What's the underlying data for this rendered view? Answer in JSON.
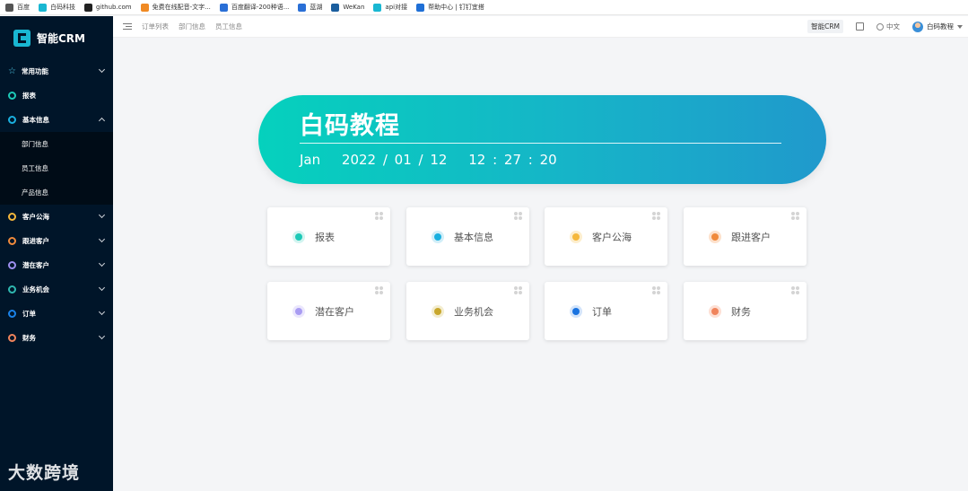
{
  "bookmarks": [
    {
      "label": "百度",
      "color": "#555555",
      "icon": "baidu-icon"
    },
    {
      "label": "白码科技",
      "color": "#19b7d2",
      "icon": "baima-icon"
    },
    {
      "label": "github.com",
      "color": "#222222",
      "icon": "github-icon"
    },
    {
      "label": "免费在线配音-文字...",
      "color": "#f08a24",
      "icon": "voice-icon"
    },
    {
      "label": "百度翻译-200种语...",
      "color": "#2a6fd6",
      "icon": "translate-icon"
    },
    {
      "label": "蓝湖",
      "color": "#2a6fd6",
      "icon": "lanhu-icon"
    },
    {
      "label": "WeKan",
      "color": "#1b5e9e",
      "icon": "wekan-icon"
    },
    {
      "label": "api对接",
      "color": "#19b7d2",
      "icon": "baima-icon"
    },
    {
      "label": "帮助中心 | 钉钉宜搭",
      "color": "#1f6fd6",
      "icon": "yida-icon"
    }
  ],
  "app": {
    "name": "智能CRM"
  },
  "sidebar": {
    "items": [
      {
        "label": "常用功能",
        "icon": "star-icon",
        "color": "#4ec9e8",
        "expanded": false
      },
      {
        "label": "报表",
        "icon": "circle-icon",
        "color": "#1dc9b7",
        "chevron": false
      },
      {
        "label": "基本信息",
        "icon": "circle-icon",
        "color": "#1ab0e0",
        "expanded": true,
        "children": [
          "部门信息",
          "员工信息",
          "产品信息"
        ]
      },
      {
        "label": "客户公海",
        "icon": "circle-icon",
        "color": "#f5b83c"
      },
      {
        "label": "跟进客户",
        "icon": "circle-icon",
        "color": "#f08a3c"
      },
      {
        "label": "潜在客户",
        "icon": "circle-icon",
        "color": "#9d8ff0"
      },
      {
        "label": "业务机会",
        "icon": "circle-icon",
        "color": "#2fb8b0"
      },
      {
        "label": "订单",
        "icon": "circle-icon",
        "color": "#1a82e8"
      },
      {
        "label": "财务",
        "icon": "circle-icon",
        "color": "#f0845c"
      }
    ]
  },
  "topbar": {
    "breadcrumbs": [
      "订单列表",
      "部门信息",
      "员工信息"
    ],
    "app_tag": "智能CRM",
    "language": "中文",
    "user": "白码教程"
  },
  "banner": {
    "title": "白码教程",
    "month": "Jan",
    "date": "2022 / 01 / 12",
    "time": "12 : 27 : 20"
  },
  "cards": [
    {
      "label": "报表",
      "color": "#1dc9b7",
      "ring": "#d2f4f0"
    },
    {
      "label": "基本信息",
      "color": "#1ab0e0",
      "ring": "#d1eef8"
    },
    {
      "label": "客户公海",
      "color": "#f5b83c",
      "ring": "#fdeecd"
    },
    {
      "label": "跟进客户",
      "color": "#f08a3c",
      "ring": "#fde1cc"
    },
    {
      "label": "潜在客户",
      "color": "#a99cf2",
      "ring": "#ebe7fd"
    },
    {
      "label": "业务机会",
      "color": "#c8a72c",
      "ring": "#f3edd0"
    },
    {
      "label": "订单",
      "color": "#1a73e0",
      "ring": "#d3e4fa"
    },
    {
      "label": "财务",
      "color": "#f0845c",
      "ring": "#fde0d5"
    }
  ],
  "watermark": "大数跨境"
}
